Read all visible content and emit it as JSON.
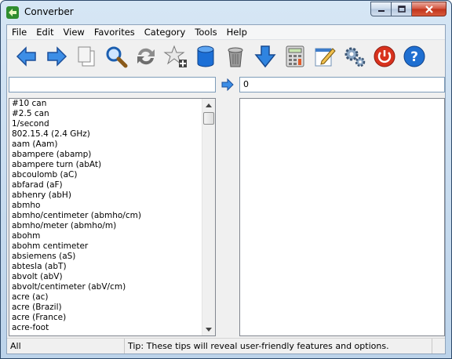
{
  "window": {
    "title": "Converber"
  },
  "menu": [
    "File",
    "Edit",
    "View",
    "Favorites",
    "Category",
    "Tools",
    "Help"
  ],
  "toolbar": [
    {
      "name": "back-button",
      "icon": "back-arrow-icon"
    },
    {
      "name": "forward-button",
      "icon": "forward-arrow-icon"
    },
    {
      "name": "copy-button",
      "icon": "copy-icon"
    },
    {
      "name": "search-button",
      "icon": "magnifier-icon"
    },
    {
      "name": "swap-button",
      "icon": "swap-arrows-icon"
    },
    {
      "name": "add-favorite-button",
      "icon": "star-add-icon"
    },
    {
      "name": "database-button",
      "icon": "database-icon"
    },
    {
      "name": "delete-button",
      "icon": "trash-icon"
    },
    {
      "name": "download-button",
      "icon": "down-arrow-icon"
    },
    {
      "name": "calculator-button",
      "icon": "calculator-icon"
    },
    {
      "name": "edit-button",
      "icon": "notepad-edit-icon"
    },
    {
      "name": "settings-button",
      "icon": "gears-icon"
    },
    {
      "name": "exit-button",
      "icon": "power-icon"
    },
    {
      "name": "help-button",
      "icon": "help-icon"
    }
  ],
  "input": {
    "value": "",
    "placeholder": ""
  },
  "result": {
    "value": "0"
  },
  "units": [
    "#10 can",
    "#2.5 can",
    "1/second",
    "802.15.4 (2.4 GHz)",
    "aam (Aam)",
    "abampere (abamp)",
    "abampere turn (abAt)",
    "abcoulomb (aC)",
    "abfarad (aF)",
    "abhenry (abH)",
    "abmho",
    "abmho/centimeter (abmho/cm)",
    "abmho/meter (abmho/m)",
    "abohm",
    "abohm centimeter",
    "absiemens (aS)",
    "abtesla (abT)",
    "abvolt (abV)",
    "abvolt/centimeter (abV/cm)",
    "acre (ac)",
    "acre (Brazil)",
    "acre (France)",
    "acre-foot"
  ],
  "status": {
    "category": "All",
    "tip": "Tip: These tips will reveal user-friendly features and options."
  },
  "colors": {
    "accent_blue": "#1f6fd1",
    "close_red": "#c0331b"
  }
}
